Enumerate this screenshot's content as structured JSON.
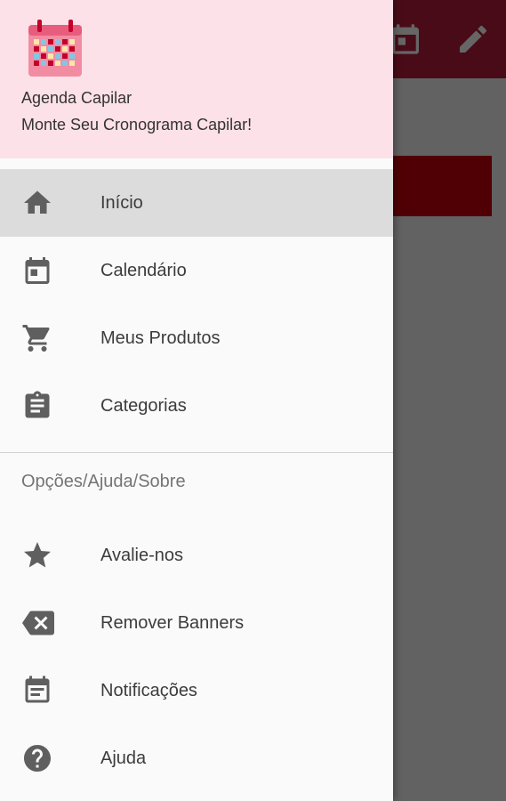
{
  "drawer_header": {
    "title": "Agenda Capilar",
    "subtitle": "Monte Seu Cronograma Capilar!",
    "background": "#fde1e8",
    "logo_icon": "calendar-logo-icon"
  },
  "toolbar": {
    "color": "#b71c3a",
    "actions": [
      {
        "icon": "calendar-icon"
      },
      {
        "icon": "edit-pencil-icon"
      }
    ]
  },
  "menu": {
    "main_items": [
      {
        "label": "Início",
        "icon": "home-icon",
        "selected": true
      },
      {
        "label": "Calendário",
        "icon": "calendar-icon",
        "selected": false
      },
      {
        "label": "Meus Produtos",
        "icon": "shopping-cart-icon",
        "selected": false
      },
      {
        "label": "Categorias",
        "icon": "clipboard-icon",
        "selected": false
      }
    ],
    "section_title": "Opções/Ajuda/Sobre",
    "secondary_items": [
      {
        "label": "Avalie-nos",
        "icon": "star-icon"
      },
      {
        "label": "Remover Banners",
        "icon": "backspace-icon"
      },
      {
        "label": "Notificações",
        "icon": "event-note-icon"
      },
      {
        "label": "Ajuda",
        "icon": "help-icon"
      }
    ]
  },
  "colors": {
    "icon": "#5f5f5f",
    "selected_row": "#dcdcdc",
    "banner": "#c8000a"
  }
}
